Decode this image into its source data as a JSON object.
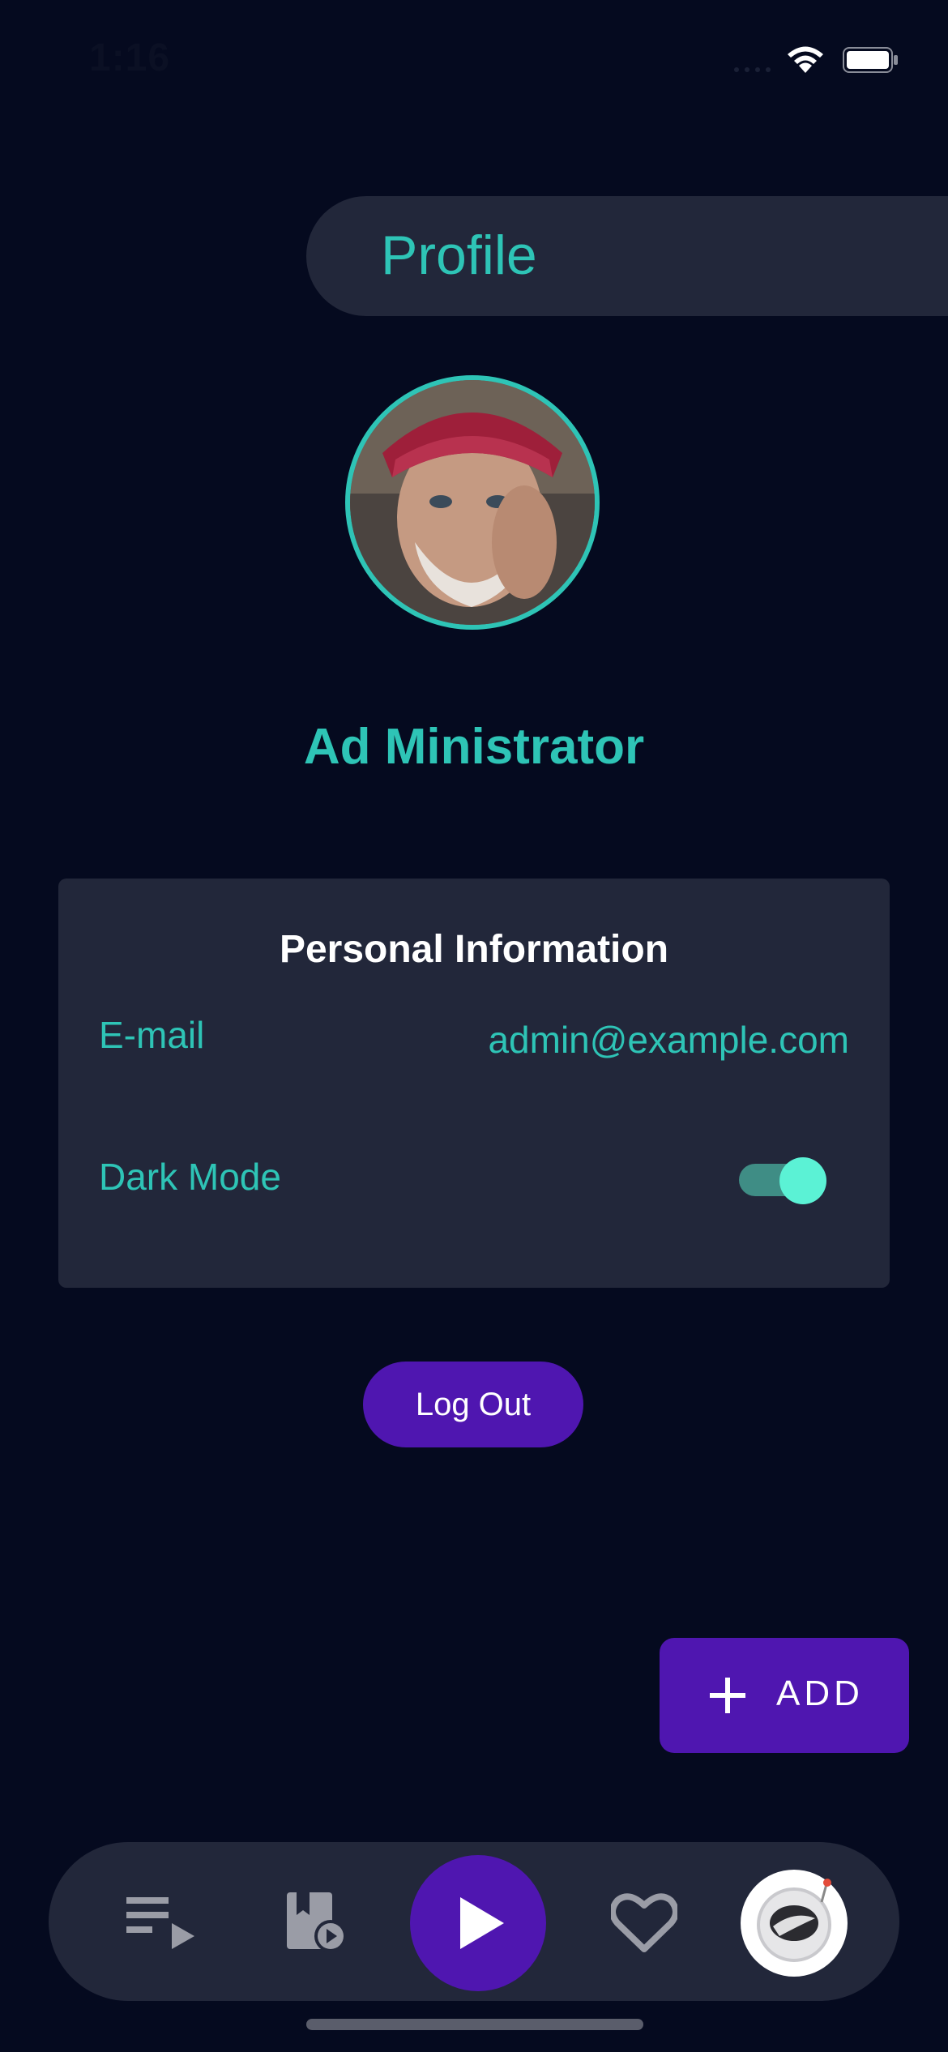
{
  "status_bar": {
    "time": "1:16"
  },
  "header": {
    "title": "Profile"
  },
  "user": {
    "name": "Ad Ministrator"
  },
  "personal_info": {
    "title": "Personal Information",
    "email_label": "E-mail",
    "email_value": "admin@example.com",
    "dark_mode_label": "Dark Mode",
    "dark_mode_enabled": true
  },
  "actions": {
    "logout_label": "Log Out",
    "add_label": "ADD"
  },
  "nav": {
    "items": [
      "playlist-icon",
      "saved-media-icon",
      "play-icon",
      "heart-icon",
      "astronaut-avatar-icon"
    ]
  },
  "colors": {
    "background": "#050a1f",
    "surface": "#22273a",
    "accent": "#2ec4b6",
    "primary": "#4f16b0",
    "toggle_knob": "#5bf2d5"
  }
}
